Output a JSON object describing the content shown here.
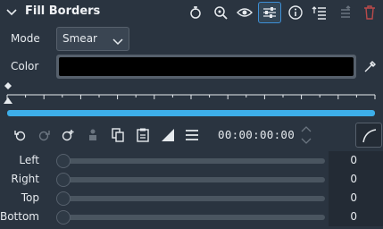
{
  "header": {
    "title": "Fill Borders",
    "icons": [
      "collapse-chevron-icon",
      "reset-icon",
      "zoom-icon",
      "eye-icon",
      "sliders-icon",
      "info-icon",
      "list-icon",
      "move-icon",
      "delete-icon"
    ]
  },
  "mode": {
    "label": "Mode",
    "value": "Smear"
  },
  "color": {
    "label": "Color",
    "value": "#000000"
  },
  "controls": {
    "icons": [
      "undo-keyframe-icon",
      "redo-keyframe-icon",
      "add-keyframe-icon",
      "person-icon",
      "copy-icon",
      "paste-icon",
      "ramp-icon",
      "menu-icon"
    ],
    "timecode": "00:00:00:00"
  },
  "progress": {
    "fraction": 1.0
  },
  "sliders": [
    {
      "label": "Left",
      "value": "0"
    },
    {
      "label": "Right",
      "value": "0"
    },
    {
      "label": "Top",
      "value": "0"
    },
    {
      "label": "Bottom",
      "value": "0"
    }
  ],
  "colors": {
    "accent": "#3daee9",
    "background": "#2a3440",
    "delete": "#d05050"
  }
}
